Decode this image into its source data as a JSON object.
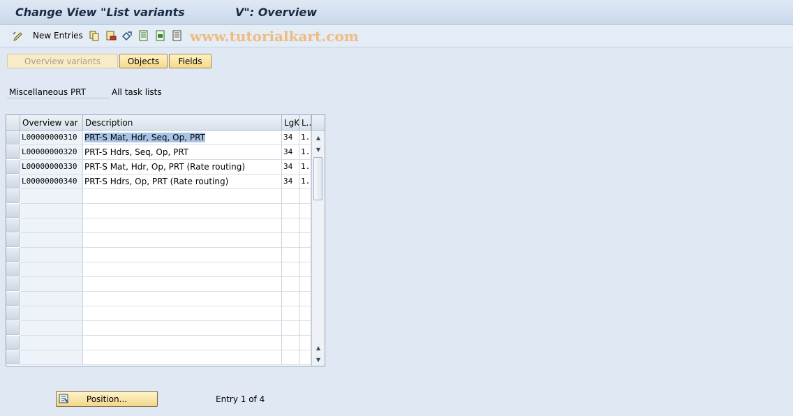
{
  "title": {
    "part1": "Change View \"List variants",
    "part2": "V\": Overview"
  },
  "toolbar": {
    "new_entries_label": "New Entries",
    "watermark": "www.tutorialkart.com"
  },
  "tabs": {
    "overview_variants": "Overview variants",
    "objects": "Objects",
    "fields": "Fields"
  },
  "header_fields": {
    "field1": "Miscellaneous PRT",
    "field2": "All task lists"
  },
  "table": {
    "columns": [
      "Overview var",
      "Description",
      "LgK",
      "L..."
    ],
    "rows": [
      {
        "var": "L00000000310",
        "desc": "PRT-S Mat, Hdr, Seq, Op, PRT",
        "lgk": "34",
        "l": "1..."
      },
      {
        "var": "L00000000320",
        "desc": "PRT-S Hdrs, Seq, Op, PRT",
        "lgk": "34",
        "l": "1..."
      },
      {
        "var": "L00000000330",
        "desc": "PRT-S Mat, Hdr, Op, PRT (Rate routing)",
        "lgk": "34",
        "l": "1..."
      },
      {
        "var": "L00000000340",
        "desc": "PRT-S Hdrs, Op, PRT (Rate routing)",
        "lgk": "34",
        "l": "1..."
      }
    ]
  },
  "footer": {
    "position_button": "Position...",
    "entry_info": "Entry 1 of 4"
  },
  "colors": {
    "background": "#dfe8f3",
    "button_fill": "#f4d98a",
    "selection": "#a9c4e6",
    "watermark": "#f0b676"
  }
}
